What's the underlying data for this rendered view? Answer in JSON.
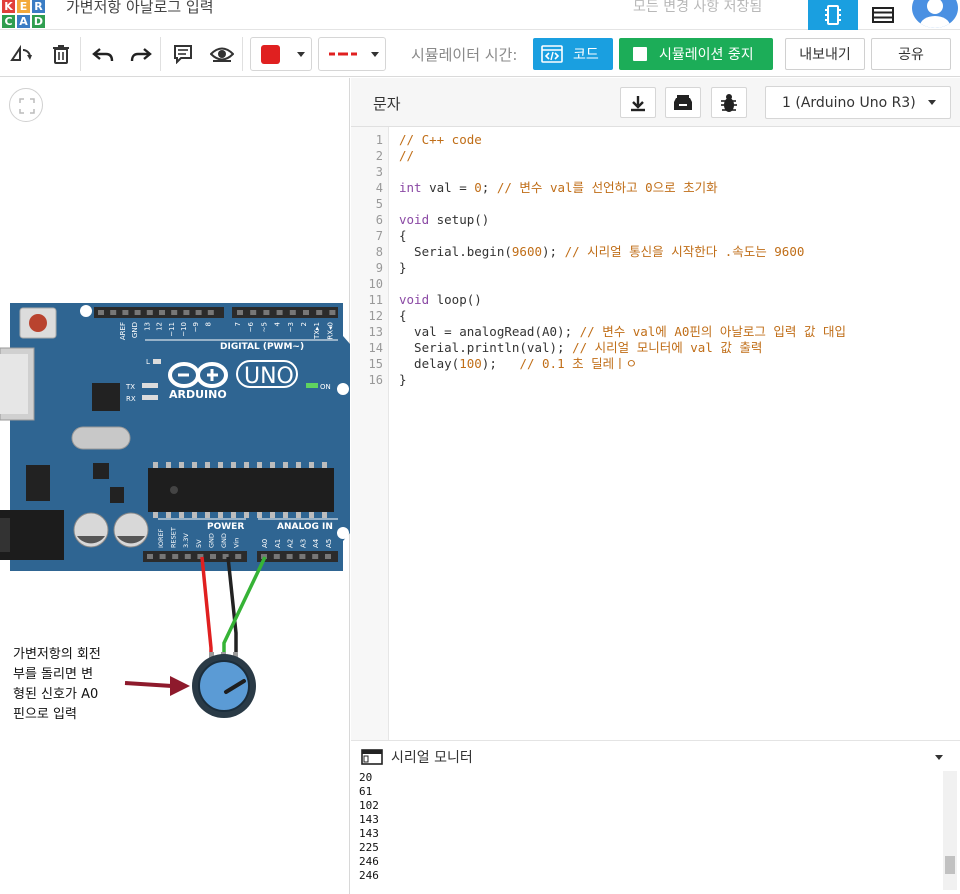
{
  "header": {
    "logo_letters": [
      "K",
      "E",
      "R",
      "C",
      "A",
      "D"
    ],
    "logo_colors": [
      "#e1403b",
      "#f3a93b",
      "#3b7dc4",
      "#2f9e4f",
      "#3b7dc4",
      "#2f9e4f"
    ],
    "title": "가변저항 아날로그 입력",
    "save_status": "모든 변경 사항 저장됨",
    "icons": [
      "circuit-view-icon",
      "component-list-icon",
      "user-avatar-icon"
    ]
  },
  "toolbar": {
    "icons": [
      "rotate-icon",
      "delete-icon",
      "undo-icon",
      "redo-icon",
      "notes-icon",
      "visibility-icon"
    ],
    "wire_color": "#e02020",
    "sim_time_label": "시뮬레이터 시간:",
    "code_button": "코드",
    "sim_button": "시뮬레이션 중지",
    "export_button": "내보내기",
    "share_button": "공유",
    "accent_blue": "#1a9fe0",
    "accent_green": "#1cad58"
  },
  "canvas": {
    "annotation": [
      "가변저항의 회전",
      "부를 돌리면 변",
      "형된 신호가 A0",
      "핀으로 입력"
    ],
    "board": {
      "brand": "ARDUINO",
      "model": "UNO",
      "digital_label": "DIGITAL (PWM~)",
      "power_label": "POWER",
      "analog_label": "ANALOG IN",
      "on_label": "ON",
      "tx": "TX",
      "rx": "RX",
      "l_label": "L",
      "top_pins": [
        "AREF",
        "GND",
        "13",
        "12",
        "~11",
        "~10",
        "~9",
        "8",
        "7",
        "~6",
        "~5",
        "4",
        "~3",
        "2",
        "TX▸1",
        "RX◂0"
      ],
      "power_pins": [
        "IOREF",
        "RESET",
        "3.3V",
        "5V",
        "GND",
        "GND",
        "Vin"
      ],
      "analog_pins": [
        "A0",
        "A1",
        "A2",
        "A3",
        "A4",
        "A5"
      ],
      "board_color": "#2f6592",
      "wire_colors": {
        "power": "#e02020",
        "ground": "#222222",
        "signal": "#36b336"
      }
    }
  },
  "code_panel": {
    "mode_label": "문자",
    "icons": [
      "download-icon",
      "library-icon",
      "debug-bug-icon"
    ],
    "device_select": "1 (Arduino Uno R3)",
    "lines": [
      [
        {
          "t": "// C++ code",
          "c": "comment"
        }
      ],
      [
        {
          "t": "//",
          "c": "comment"
        }
      ],
      [],
      [
        {
          "t": "int",
          "c": "kw"
        },
        {
          "t": " val = ",
          "c": "text"
        },
        {
          "t": "0",
          "c": "num"
        },
        {
          "t": "; ",
          "c": "text"
        },
        {
          "t": "// 변수 val를 선언하고 0으로 초기화",
          "c": "comment"
        }
      ],
      [],
      [
        {
          "t": "void",
          "c": "kw"
        },
        {
          "t": " setup()",
          "c": "text"
        }
      ],
      [
        {
          "t": "{",
          "c": "text"
        }
      ],
      [
        {
          "t": "  Serial.begin(",
          "c": "text"
        },
        {
          "t": "9600",
          "c": "num"
        },
        {
          "t": "); ",
          "c": "text"
        },
        {
          "t": "// 시리얼 통신을 시작한다 .속도는 9600",
          "c": "comment"
        }
      ],
      [
        {
          "t": "}",
          "c": "text"
        }
      ],
      [],
      [
        {
          "t": "void",
          "c": "kw"
        },
        {
          "t": " loop()",
          "c": "text"
        }
      ],
      [
        {
          "t": "{",
          "c": "text"
        }
      ],
      [
        {
          "t": "  val = analogRead(A0); ",
          "c": "text"
        },
        {
          "t": "// 변수 val에 A0핀의 아날로그 입력 값 대입",
          "c": "comment"
        }
      ],
      [
        {
          "t": "  Serial.println(val); ",
          "c": "text"
        },
        {
          "t": "// 시리얼 모니터에 val 값 출력",
          "c": "comment"
        }
      ],
      [
        {
          "t": "  delay(",
          "c": "text"
        },
        {
          "t": "100",
          "c": "num"
        },
        {
          "t": ");   ",
          "c": "text"
        },
        {
          "t": "// 0.1 초 딜레ㅣㅇ",
          "c": "comment"
        }
      ],
      [
        {
          "t": "}",
          "c": "text"
        }
      ]
    ]
  },
  "serial_monitor": {
    "title": "시리얼 모니터",
    "icons": [
      "monitor-window-icon",
      "collapse-caret-icon"
    ],
    "output": [
      "20",
      "61",
      "102",
      "143",
      "143",
      "225",
      "246",
      "246"
    ]
  }
}
